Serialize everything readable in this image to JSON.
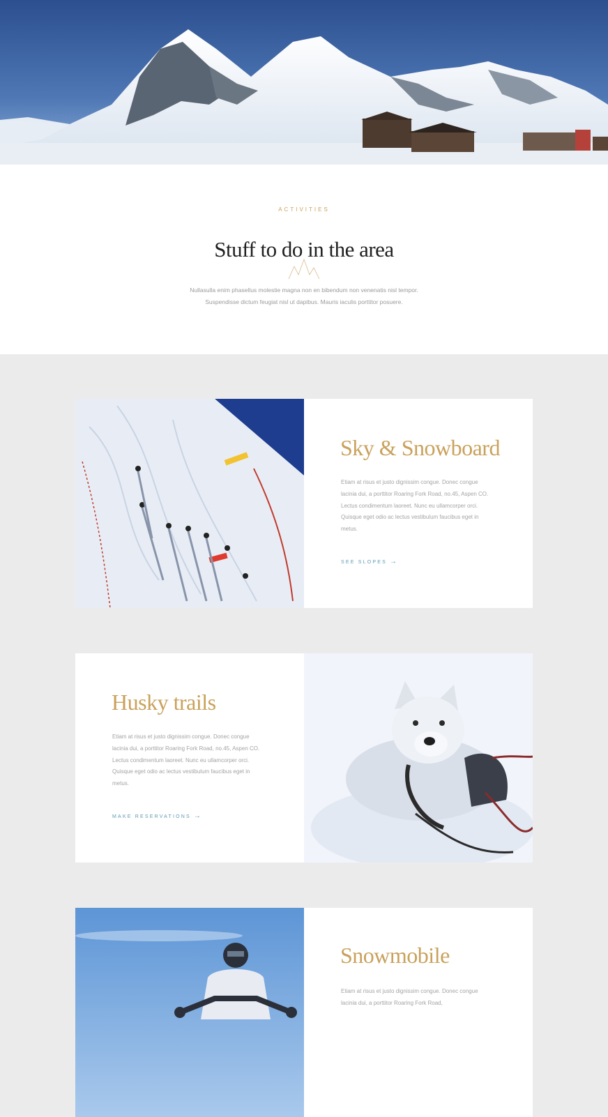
{
  "hero": {
    "image": "snowy-mountain-peaks-with-chalets"
  },
  "intro": {
    "eyebrow": "ACTIVITIES",
    "title": "Stuff to do in the area",
    "body": "Nullasulla enim phasellus molestie magna non en bibendum non venenatis nisl tempor. Suspendisse dictum feugiat nisl ut dapibus. Mauris iaculis porttitor posuere."
  },
  "activities": [
    {
      "title": "Sky & Snowboard",
      "body": "Etiam at risus et justo dignissim congue. Donec congue lacinia dui, a porttitor Roaring Fork Road, no.45, Aspen CO. Lectus condimentum laoreet. Nunc eu ullamcorper orci. Quisque eget odio ac lectus vestibulum faucibus eget in metus.",
      "link": "SEE SLOPES",
      "image": "skiers-on-slope"
    },
    {
      "title": "Husky trails",
      "body": "Etiam at risus et justo dignissim congue. Donec congue lacinia dui, a porttitor Roaring Fork Road, no.45, Aspen CO. Lectus condimentum laoreet. Nunc eu ullamcorper orci. Quisque eget odio ac lectus vestibulum faucibus eget in metus.",
      "link": "MAKE RESERVATIONS",
      "image": "husky-in-snow"
    },
    {
      "title": "Snowmobile",
      "body": "Etiam at risus et justo dignissim congue. Donec congue lacinia dui, a porttitor Roaring Fork Road,",
      "link": "",
      "image": "snowmobile-rider"
    }
  ],
  "icons": {
    "link_arrow": "arrow-right-icon",
    "title_ornament": "mountain-ornament-icon"
  },
  "colors": {
    "accent_gold": "#c9a15b",
    "link_blue": "#5e9bb5",
    "section_bg": "#ebebeb"
  }
}
